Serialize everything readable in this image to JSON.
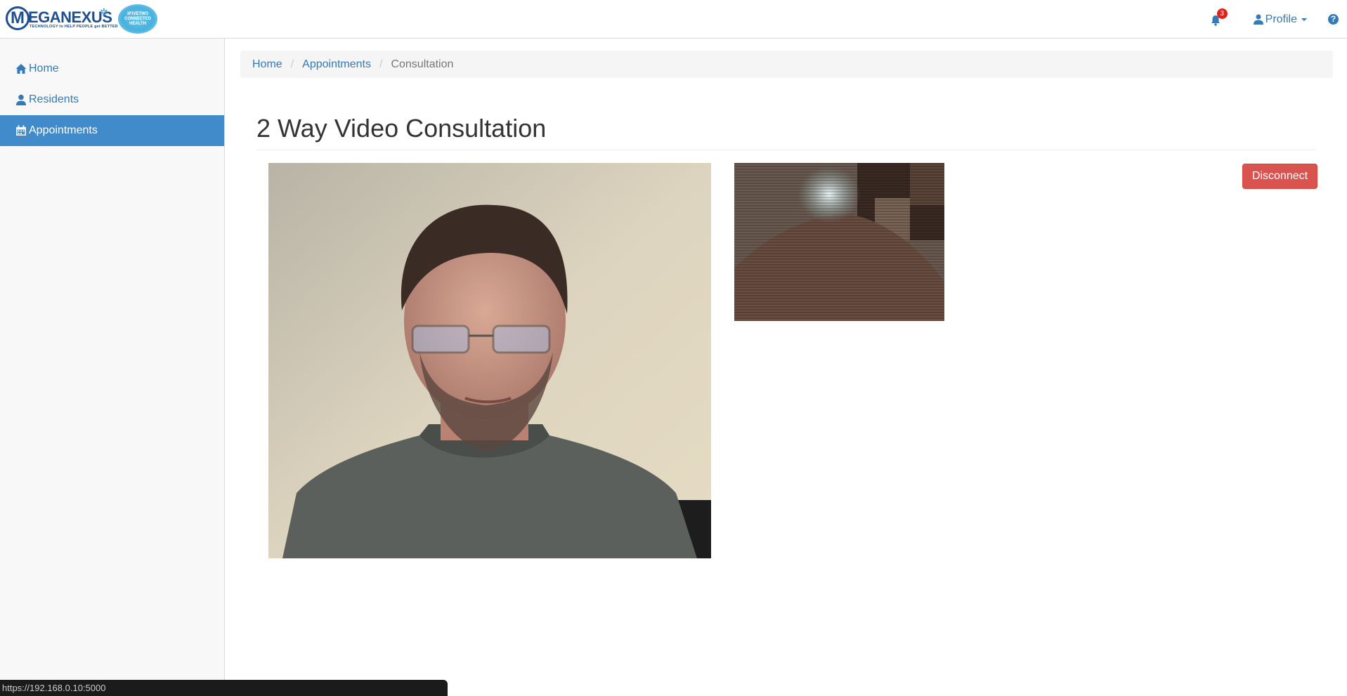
{
  "brand": {
    "name": "MEGANEXUS",
    "tagline": "TECHNOLOGY to HELP PEOPLE get BETTER",
    "partner_lines": [
      "3FIVETWO",
      "CONNECTED",
      "HEALTH"
    ]
  },
  "navbar": {
    "notification_count": "3",
    "profile_label": "Profile",
    "help_icon": "question-circle-icon"
  },
  "sidebar": {
    "items": [
      {
        "label": "Home",
        "icon": "home-icon"
      },
      {
        "label": "Residents",
        "icon": "user-icon"
      },
      {
        "label": "Appointments",
        "icon": "calendar-icon",
        "active": true
      }
    ]
  },
  "breadcrumb": {
    "items": [
      "Home",
      "Appointments",
      "Consultation"
    ]
  },
  "page": {
    "title": "2 Way Video Consultation",
    "disconnect_label": "Disconnect"
  },
  "statusbar": {
    "url": "https://192.168.0.10:5000"
  },
  "colors": {
    "primary": "#337ab7",
    "active_bg": "#428bca",
    "danger": "#d9534f",
    "badge": "#e0201b"
  }
}
